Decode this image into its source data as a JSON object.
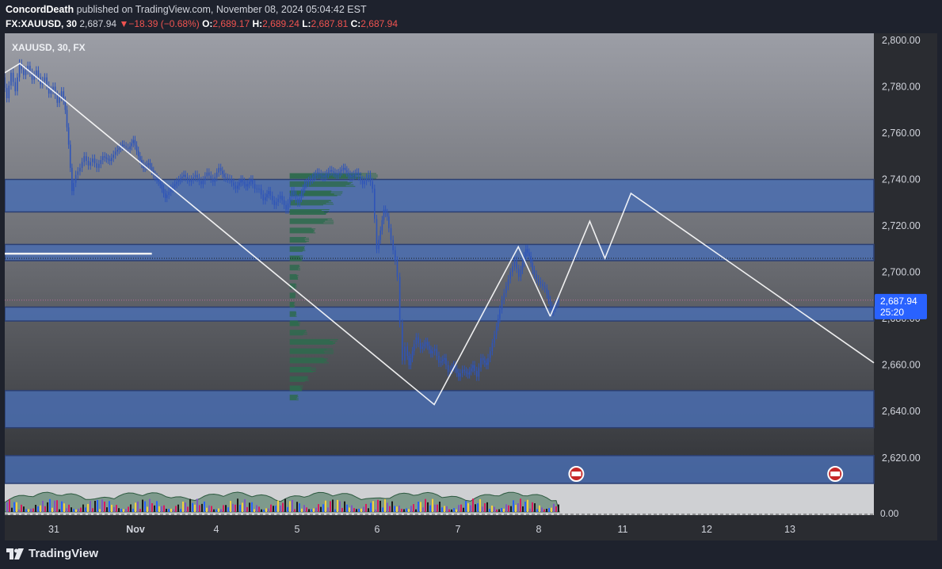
{
  "header": {
    "author": "ConcordDeath",
    "published_text": "published on TradingView.com, November 08, 2024 05:04:42 EST",
    "symbol_line": "FX:XAUUSD, 30",
    "last": "2,687.94",
    "change_arrow": "▼",
    "change": "−18.39 (−0.68%)",
    "o_label": "O:",
    "o_value": "2,689.17",
    "h_label": "H:",
    "h_value": "2,689.24",
    "l_label": "L:",
    "l_value": "2,687.81",
    "c_label": "C:",
    "c_value": "2,687.94"
  },
  "legend_title": "XAUUSD, 30, FX",
  "price_tag": {
    "price": "2,687.94",
    "countdown": "25:20"
  },
  "volume_zero_label": "0.00",
  "footer": {
    "brand": "TradingView",
    "logo_icon": "tradingview-logo-icon"
  },
  "colors": {
    "background_top": "#9a9ca4",
    "background_bottom": "#2f3135",
    "zone_fill": "#4a6db0",
    "zone_border": "#2b3f72",
    "candle": "#2f55b8",
    "volume_profile": "#2e6b4e",
    "projection_line": "#ffffff",
    "price_tag": "#2962ff",
    "down": "#ef5350"
  },
  "chart_data": {
    "type": "candlestick",
    "instrument": "XAUUSD",
    "interval": "30",
    "exchange": "FX",
    "y_axis_ticks": [
      "2,800.00",
      "2,780.00",
      "2,760.00",
      "2,740.00",
      "2,720.00",
      "2,700.00",
      "2,680.00",
      "2,660.00",
      "2,640.00",
      "2,620.00"
    ],
    "y_tick_values": [
      2800,
      2780,
      2760,
      2740,
      2720,
      2700,
      2680,
      2660,
      2640,
      2620
    ],
    "ylim": [
      2609,
      2803
    ],
    "x_axis_ticks": [
      "31",
      "Nov",
      "4",
      "5",
      "6",
      "7",
      "8",
      "11",
      "12",
      "13"
    ],
    "x_tick_index": [
      0,
      1,
      2,
      3,
      4,
      5,
      6,
      7,
      8,
      9
    ],
    "xlim": [
      -0.37,
      9.97
    ],
    "price_path": [
      [
        -0.37,
        2784
      ],
      [
        -0.32,
        2775
      ],
      [
        -0.27,
        2786
      ],
      [
        -0.22,
        2778
      ],
      [
        -0.17,
        2790
      ],
      [
        -0.12,
        2785
      ],
      [
        -0.07,
        2789
      ],
      [
        -0.02,
        2783
      ],
      [
        0.03,
        2787
      ],
      [
        0.08,
        2781
      ],
      [
        0.13,
        2784
      ],
      [
        0.18,
        2777
      ],
      [
        0.23,
        2780
      ],
      [
        0.28,
        2773
      ],
      [
        0.33,
        2778
      ],
      [
        0.37,
        2770
      ],
      [
        0.41,
        2755
      ],
      [
        0.45,
        2735
      ],
      [
        0.5,
        2742
      ],
      [
        0.55,
        2745
      ],
      [
        0.6,
        2750
      ],
      [
        0.65,
        2746
      ],
      [
        0.7,
        2749
      ],
      [
        0.75,
        2745
      ],
      [
        0.82,
        2750
      ],
      [
        0.9,
        2748
      ],
      [
        0.97,
        2752
      ],
      [
        1.05,
        2755
      ],
      [
        1.12,
        2753
      ],
      [
        1.18,
        2757
      ],
      [
        1.24,
        2750
      ],
      [
        1.3,
        2745
      ],
      [
        1.36,
        2747
      ],
      [
        1.42,
        2742
      ],
      [
        1.5,
        2738
      ],
      [
        1.56,
        2732
      ],
      [
        1.63,
        2736
      ],
      [
        1.7,
        2739
      ],
      [
        1.78,
        2742
      ],
      [
        1.85,
        2739
      ],
      [
        1.92,
        2742
      ],
      [
        1.99,
        2738
      ],
      [
        2.06,
        2743
      ],
      [
        2.13,
        2739
      ],
      [
        2.2,
        2745
      ],
      [
        2.26,
        2741
      ],
      [
        2.33,
        2740
      ],
      [
        2.4,
        2736
      ],
      [
        2.46,
        2740
      ],
      [
        2.52,
        2737
      ],
      [
        2.58,
        2740
      ],
      [
        2.63,
        2736
      ],
      [
        2.68,
        2736
      ],
      [
        2.73,
        2731
      ],
      [
        2.79,
        2735
      ],
      [
        2.86,
        2729
      ],
      [
        2.93,
        2733
      ],
      [
        3.0,
        2727
      ],
      [
        3.07,
        2735
      ],
      [
        3.14,
        2730
      ],
      [
        3.22,
        2738
      ],
      [
        3.29,
        2740
      ],
      [
        3.37,
        2743
      ],
      [
        3.44,
        2741
      ],
      [
        3.52,
        2744
      ],
      [
        3.6,
        2742
      ],
      [
        3.68,
        2745
      ],
      [
        3.76,
        2741
      ],
      [
        3.84,
        2743
      ],
      [
        3.91,
        2738
      ],
      [
        3.98,
        2742
      ],
      [
        4.03,
        2736
      ],
      [
        4.08,
        2710
      ],
      [
        4.12,
        2718
      ],
      [
        4.16,
        2727
      ],
      [
        4.2,
        2724
      ],
      [
        4.25,
        2714
      ],
      [
        4.3,
        2705
      ],
      [
        4.33,
        2698
      ],
      [
        4.36,
        2678
      ],
      [
        4.39,
        2662
      ],
      [
        4.42,
        2668
      ],
      [
        4.46,
        2660
      ],
      [
        4.5,
        2666
      ],
      [
        4.55,
        2672
      ],
      [
        4.6,
        2667
      ],
      [
        4.66,
        2670
      ],
      [
        4.72,
        2665
      ],
      [
        4.77,
        2667
      ],
      [
        4.82,
        2661
      ],
      [
        4.88,
        2663
      ],
      [
        4.93,
        2657
      ],
      [
        4.99,
        2660
      ],
      [
        5.05,
        2655
      ],
      [
        5.1,
        2658
      ],
      [
        5.16,
        2656
      ],
      [
        5.22,
        2660
      ],
      [
        5.27,
        2655
      ],
      [
        5.32,
        2663
      ],
      [
        5.38,
        2660
      ],
      [
        5.43,
        2666
      ],
      [
        5.48,
        2673
      ],
      [
        5.52,
        2680
      ],
      [
        5.57,
        2688
      ],
      [
        5.62,
        2694
      ],
      [
        5.67,
        2700
      ],
      [
        5.72,
        2705
      ],
      [
        5.77,
        2698
      ],
      [
        5.81,
        2704
      ],
      [
        5.85,
        2710
      ],
      [
        5.89,
        2707
      ],
      [
        5.93,
        2701
      ],
      [
        5.98,
        2697
      ],
      [
        6.03,
        2695
      ],
      [
        6.08,
        2693
      ],
      [
        6.12,
        2688
      ],
      [
        6.16,
        2683
      ],
      [
        6.2,
        2686
      ],
      [
        6.24,
        2688
      ]
    ],
    "zones": [
      {
        "from": 2726,
        "to": 2740
      },
      {
        "from": 2705,
        "to": 2712
      },
      {
        "from": 2679,
        "to": 2685
      },
      {
        "from": 2633,
        "to": 2649
      },
      {
        "from": 2609,
        "to": 2621
      }
    ],
    "horizontal_lines": [
      {
        "price": 2708,
        "x_from": -0.37,
        "x_to": 1.38,
        "style": "solid"
      },
      {
        "price": 2706,
        "x_from": -0.37,
        "x_to": 9.97,
        "style": "dotted"
      },
      {
        "price": 2688,
        "x_from": -0.37,
        "x_to": 9.97,
        "style": "dotted-pink"
      }
    ],
    "drawn_lines": [
      [
        [
          -0.37,
          2786
        ],
        [
          -0.19,
          2790
        ],
        [
          4.74,
          2643
        ],
        [
          5.74,
          2711
        ],
        [
          6.12,
          2681
        ]
      ],
      [
        [
          6.12,
          2681
        ],
        [
          6.59,
          2722
        ],
        [
          6.77,
          2706
        ],
        [
          7.08,
          2734
        ],
        [
          9.97,
          2661
        ]
      ]
    ],
    "volume_profile": {
      "x_start": 3.02,
      "levels": [
        2741.5,
        2738,
        2734,
        2730,
        2726,
        2722,
        2718,
        2714,
        2710,
        2706,
        2702,
        2698,
        2694,
        2690,
        2686,
        2682,
        2678,
        2674,
        2670,
        2666,
        2662,
        2658,
        2654,
        2650,
        2646
      ],
      "widths": [
        1.0,
        0.75,
        0.6,
        0.5,
        0.45,
        0.5,
        0.3,
        0.22,
        0.18,
        0.15,
        0.12,
        0.1,
        0.08,
        0.07,
        0.06,
        0.08,
        0.12,
        0.2,
        0.55,
        0.5,
        0.45,
        0.3,
        0.22,
        0.15,
        0.1
      ]
    },
    "event_markers": [
      6.43,
      9.51
    ],
    "volume_oscillator": {
      "zero_value": 0.0
    }
  }
}
